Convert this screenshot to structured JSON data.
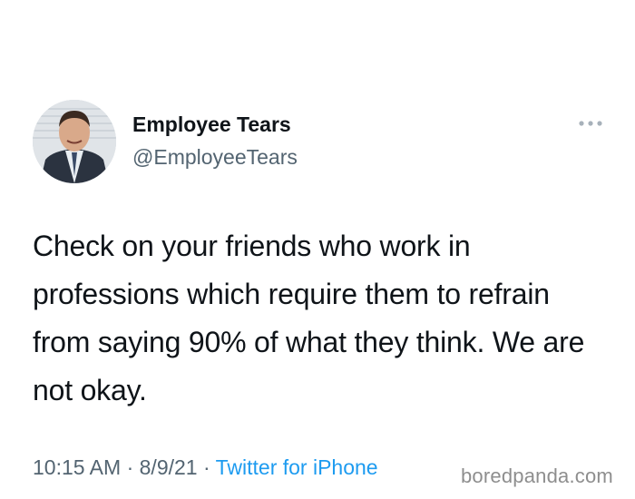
{
  "tweet": {
    "author_name": "Employee Tears",
    "author_handle": "@EmployeeTears",
    "text": "Check on your friends who work in professions which require them to refrain from saying 90% of what they think. We are not okay.",
    "time": "10:15 AM",
    "date": "8/9/21",
    "separator": " · ",
    "source": "Twitter for iPhone"
  },
  "icons": {
    "more": "more-horizontal-icon",
    "avatar": "profile-photo"
  },
  "watermark": "boredpanda.com",
  "colors": {
    "text_primary": "#0f1419",
    "text_secondary": "#536471",
    "link": "#1d9bf0",
    "watermark": "#8e8e8e"
  }
}
